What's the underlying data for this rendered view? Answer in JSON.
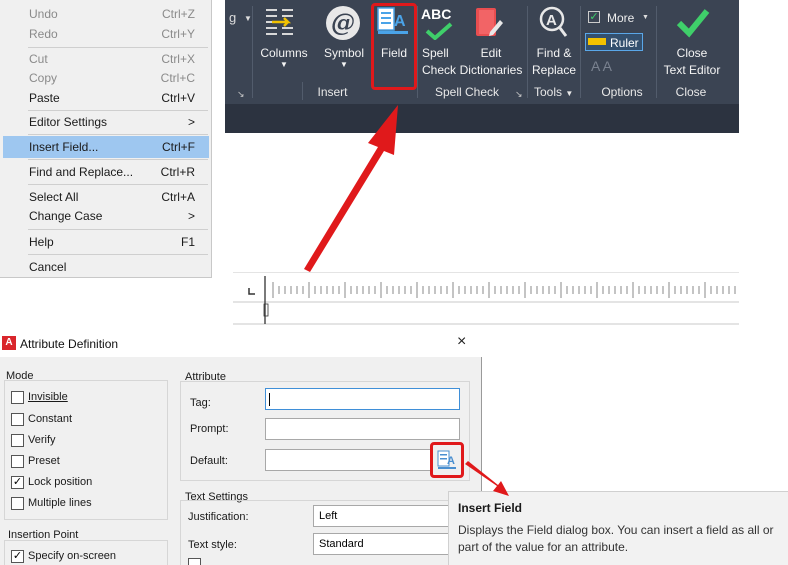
{
  "context_menu": {
    "items": [
      {
        "label": "Undo",
        "shortcut": "Ctrl+Z"
      },
      {
        "label": "Redo",
        "shortcut": "Ctrl+Y"
      },
      {
        "label": "Cut",
        "shortcut": "Ctrl+X"
      },
      {
        "label": "Copy",
        "shortcut": "Ctrl+C"
      },
      {
        "label": "Paste",
        "shortcut": "Ctrl+V"
      },
      {
        "label": "Editor Settings",
        "shortcut": ">"
      },
      {
        "label": "Insert Field...",
        "shortcut": "Ctrl+F"
      },
      {
        "label": "Find and Replace...",
        "shortcut": "Ctrl+R"
      },
      {
        "label": "Select All",
        "shortcut": "Ctrl+A"
      },
      {
        "label": "Change Case",
        "shortcut": ">"
      },
      {
        "label": "Help",
        "shortcut": "F1"
      },
      {
        "label": "Cancel",
        "shortcut": ""
      }
    ]
  },
  "ribbon": {
    "partial_left": "g",
    "buttons": {
      "columns": "Columns",
      "symbol": "Symbol",
      "field": "Field",
      "spell_check_1": "Spell",
      "spell_check_2": "Check",
      "edit_dict_1": "Edit",
      "edit_dict_2": "Dictionaries",
      "find_1": "Find &",
      "find_2": "Replace",
      "more": "More",
      "ruler": "Ruler",
      "close_1": "Close",
      "close_2": "Text Editor",
      "abc": "ABC"
    },
    "panels": {
      "insert": "Insert",
      "spell_check": "Spell Check",
      "tools": "Tools",
      "options": "Options",
      "close": "Close"
    }
  },
  "dialog": {
    "title": "Attribute Definition",
    "close": "×",
    "mode": {
      "title": "Mode",
      "invisible": "Invisible",
      "constant": "Constant",
      "verify": "Verify",
      "preset": "Preset",
      "lock_position": "Lock position",
      "multiple_lines": "Multiple lines"
    },
    "insertion_point": {
      "title": "Insertion Point",
      "specify_on_screen": "Specify on-screen"
    },
    "attribute": {
      "title": "Attribute",
      "tag": "Tag:",
      "prompt": "Prompt:",
      "default": "Default:"
    },
    "text_settings": {
      "title": "Text Settings",
      "justification_label": "Justification:",
      "justification_value": "Left",
      "text_style_label": "Text style:",
      "text_style_value": "Standard"
    }
  },
  "tooltip": {
    "title": "Insert Field",
    "body": "Displays the Field dialog box. You can insert a field as all or part of the value for an attribute."
  },
  "colors": {
    "highlight": "#e0191b",
    "ribbon_bg": "#3b4453",
    "menu_selected": "#9ec7f0",
    "close_check": "#3fcf6a"
  }
}
